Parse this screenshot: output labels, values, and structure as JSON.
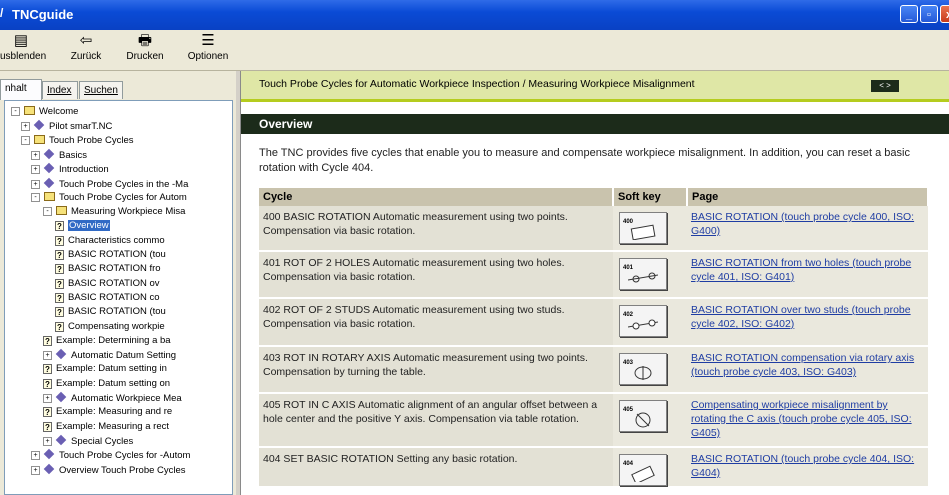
{
  "window": {
    "title": "TNCguide"
  },
  "toolbar": {
    "buttons": [
      {
        "label": "usblenden",
        "icon": "hide-pane-icon"
      },
      {
        "label": "Zurück",
        "icon": "back-arrow-icon"
      },
      {
        "label": "Drucken",
        "icon": "print-icon"
      },
      {
        "label": "Optionen",
        "icon": "options-icon"
      }
    ]
  },
  "tabs": [
    "nhalt",
    "Index",
    "Suchen"
  ],
  "tree": [
    {
      "label": "Welcome",
      "icon": "book-open-icon",
      "level": 0,
      "expander": "-"
    },
    {
      "label": "Pilot smarT.NC",
      "icon": "diamond-icon",
      "level": 1,
      "expander": "+"
    },
    {
      "label": "Touch Probe Cycles",
      "icon": "book-open-icon",
      "level": 1,
      "expander": "-"
    },
    {
      "label": "Basics",
      "icon": "diamond-icon",
      "level": 2,
      "expander": "+"
    },
    {
      "label": "Introduction",
      "icon": "diamond-icon",
      "level": 2,
      "expander": "+"
    },
    {
      "label": "Touch Probe Cycles in the -Ma",
      "icon": "diamond-icon",
      "level": 2,
      "expander": "+"
    },
    {
      "label": "Touch Probe Cycles for Autom",
      "icon": "book-open-icon",
      "level": 2,
      "expander": "-"
    },
    {
      "label": "Measuring Workpiece Misa",
      "icon": "book-open-icon",
      "level": 3,
      "expander": "-"
    },
    {
      "label": "Overview",
      "icon": "help-page-icon",
      "level": 4,
      "selected": true
    },
    {
      "label": "Characteristics commo",
      "icon": "help-page-icon",
      "level": 4
    },
    {
      "label": "BASIC ROTATION (tou",
      "icon": "help-page-icon",
      "level": 4
    },
    {
      "label": "BASIC ROTATION fro",
      "icon": "help-page-icon",
      "level": 4
    },
    {
      "label": "BASIC ROTATION ov",
      "icon": "help-page-icon",
      "level": 4
    },
    {
      "label": "BASIC ROTATION co",
      "icon": "help-page-icon",
      "level": 4
    },
    {
      "label": "BASIC ROTATION (tou",
      "icon": "help-page-icon",
      "level": 4
    },
    {
      "label": "Compensating workpie",
      "icon": "help-page-icon",
      "level": 4
    },
    {
      "label": "Example: Determining a ba",
      "icon": "help-page-icon",
      "level": 3
    },
    {
      "label": "Automatic Datum Setting",
      "icon": "diamond-icon",
      "level": 3,
      "expander": "+"
    },
    {
      "label": "Example: Datum setting in",
      "icon": "help-page-icon",
      "level": 3
    },
    {
      "label": "Example: Datum setting on",
      "icon": "help-page-icon",
      "level": 3
    },
    {
      "label": "Automatic Workpiece Mea",
      "icon": "diamond-icon",
      "level": 3,
      "expander": "+"
    },
    {
      "label": "Example: Measuring and re",
      "icon": "help-page-icon",
      "level": 3
    },
    {
      "label": "Example: Measuring a rect",
      "icon": "help-page-icon",
      "level": 3
    },
    {
      "label": "Special Cycles",
      "icon": "diamond-icon",
      "level": 3,
      "expander": "+"
    },
    {
      "label": "Touch Probe Cycles for -Autom",
      "icon": "diamond-icon",
      "level": 2,
      "expander": "+"
    },
    {
      "label": "Overview Touch Probe Cycles",
      "icon": "diamond-icon",
      "level": 2,
      "expander": "+"
    }
  ],
  "content": {
    "breadcrumb": "Touch Probe Cycles for Automatic Workpiece Inspection / Measuring Workpiece Misalignment",
    "nav_arrows": "< >",
    "heading": "Overview",
    "intro": "The TNC provides five cycles that enable you to measure and compensate workpiece misalignment. In addition, you can reset a basic rotation with Cycle 404.",
    "columns": [
      "Cycle",
      "Soft key",
      "Page"
    ],
    "rows": [
      {
        "cycle": "400 BASIC ROTATION Automatic measurement using two points. Compensation via basic rotation.",
        "softkey": "400",
        "page": "BASIC ROTATION (touch probe cycle 400, ISO: G400)"
      },
      {
        "cycle": "401 ROT OF 2 HOLES Automatic measurement using two holes. Compensation via basic rotation.",
        "softkey": "401",
        "page": "BASIC ROTATION from two holes (touch probe cycle 401, ISO: G401)"
      },
      {
        "cycle": "402 ROT OF 2 STUDS Automatic measurement using two studs. Compensation via basic rotation.",
        "softkey": "402",
        "page": "BASIC ROTATION over two studs (touch probe cycle 402, ISO: G402)"
      },
      {
        "cycle": "403 ROT IN ROTARY AXIS Automatic measurement using two points. Compensation by turning the table.",
        "softkey": "403",
        "page": "BASIC ROTATION compensation via rotary axis (touch probe cycle 403, ISO: G403)"
      },
      {
        "cycle": "405 ROT IN C AXIS Automatic alignment of an angular offset between a hole center and the positive Y axis. Compensation via table rotation.",
        "softkey": "405",
        "page": "Compensating workpiece misalignment by rotating the C axis (touch probe cycle 405, ISO: G405)"
      },
      {
        "cycle": "404 SET BASIC ROTATION Setting any basic rotation.",
        "softkey": "404",
        "page": "BASIC ROTATION (touch probe cycle 404, ISO: G404)"
      }
    ]
  }
}
